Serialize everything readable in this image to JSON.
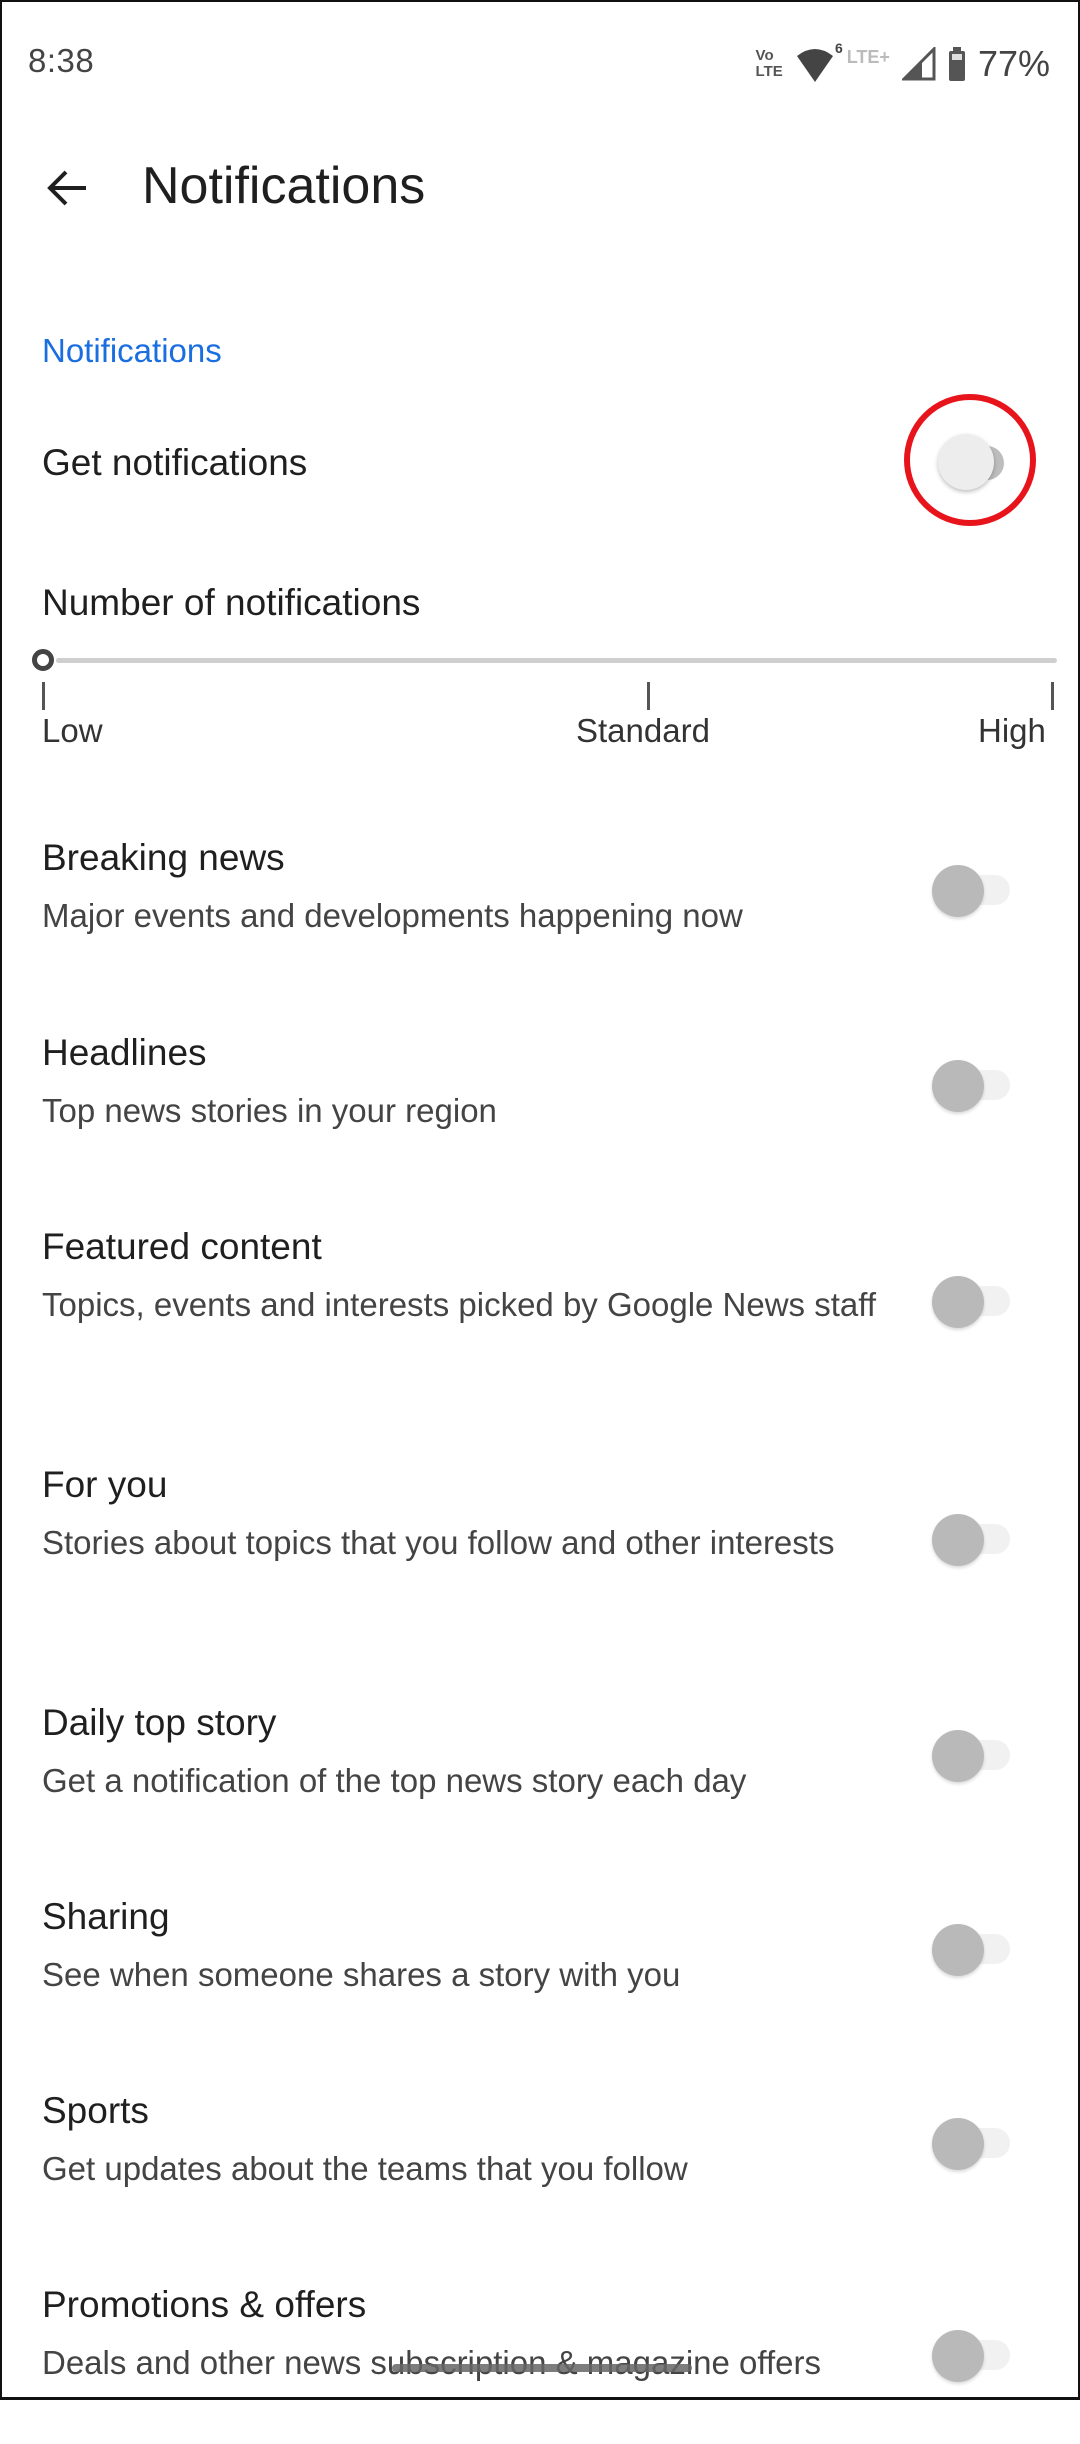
{
  "status_bar": {
    "time": "8:38",
    "volte_top": "Vo",
    "volte_bottom": "LTE",
    "wifi_badge": "6",
    "lte_plus": "LTE+",
    "battery_percent": "77%",
    "icons": [
      "volte-icon",
      "wifi-icon",
      "lte-plus-icon",
      "cell-signal-icon",
      "battery-icon"
    ]
  },
  "app_bar": {
    "back_icon": "arrow-left-icon",
    "title": "Notifications"
  },
  "section_header": "Notifications",
  "master_toggle": {
    "label": "Get notifications",
    "checked": false,
    "highlighted": true
  },
  "frequency_slider": {
    "label": "Number of notifications",
    "options": [
      "Low",
      "Standard",
      "High"
    ],
    "selected": "Low",
    "value_fraction": 0
  },
  "categories": [
    {
      "title": "Breaking news",
      "description": "Major events and developments happening now",
      "checked": false,
      "enabled": false
    },
    {
      "title": "Headlines",
      "description": "Top news stories in your region",
      "checked": false,
      "enabled": false
    },
    {
      "title": "Featured content",
      "description": "Topics, events and interests picked by Google News staff",
      "checked": false,
      "enabled": false
    },
    {
      "title": "For you",
      "description": "Stories about topics that you follow and other interests",
      "checked": false,
      "enabled": false
    },
    {
      "title": "Daily top story",
      "description": "Get a notification of the top news story each day",
      "checked": false,
      "enabled": false
    },
    {
      "title": "Sharing",
      "description": "See when someone shares a story with you",
      "checked": false,
      "enabled": false
    },
    {
      "title": "Sports",
      "description": "Get updates about the teams that you follow",
      "checked": false,
      "enabled": false
    },
    {
      "title": "Promotions & offers",
      "description": "Deals and other news subscription & magazine offers",
      "checked": false,
      "enabled": false
    }
  ],
  "colors": {
    "accent": "#1a6ee0",
    "highlight_ring": "#e8141b",
    "toggle_thumb_disabled": "#b9b9b9"
  }
}
